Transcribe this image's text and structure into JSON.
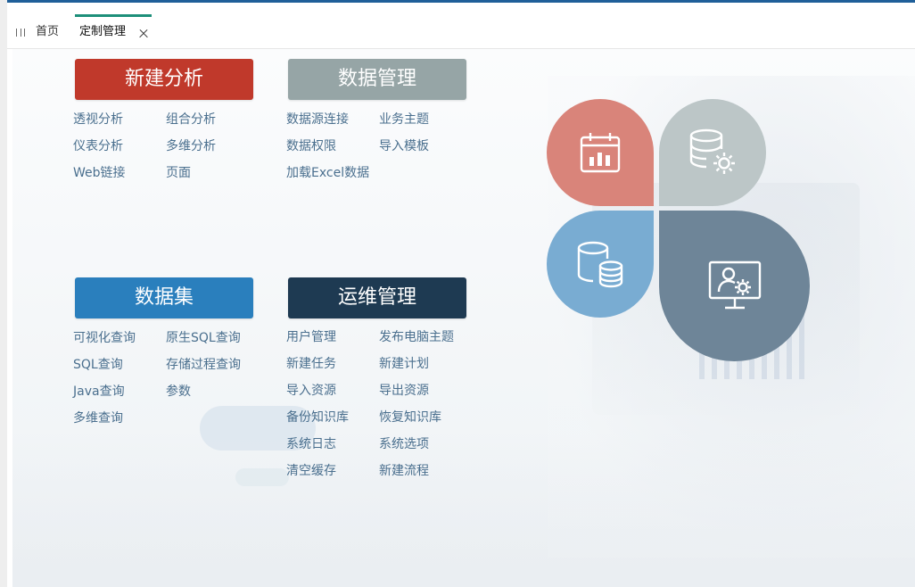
{
  "tabs": [
    {
      "label": "首页"
    },
    {
      "label": "定制管理"
    }
  ],
  "groups": {
    "new_analysis": {
      "title": "新建分析",
      "color": "#c0392b",
      "items": [
        "透视分析",
        "组合分析",
        "仪表分析",
        "多维分析",
        "Web链接",
        "页面"
      ]
    },
    "data_management": {
      "title": "数据管理",
      "color": "#96a5a6",
      "items": [
        "数据源连接",
        "业务主题",
        "数据权限",
        "导入模板",
        "加载Excel数据"
      ]
    },
    "dataset": {
      "title": "数据集",
      "color": "#2a7fbd",
      "items": [
        "可视化查询",
        "原生SQL查询",
        "SQL查询",
        "存储过程查询",
        "Java查询",
        "参数",
        "多维查询"
      ]
    },
    "operations": {
      "title": "运维管理",
      "color": "#1e3a52",
      "items": [
        "用户管理",
        "发布电脑主题",
        "新建任务",
        "新建计划",
        "导入资源",
        "导出资源",
        "备份知识库",
        "恢复知识库",
        "系统日志",
        "系统选项",
        "清空缓存",
        "新建流程"
      ]
    }
  },
  "graphic": {
    "petals": [
      {
        "icon": "calendar-chart-icon",
        "color": "#d9847a"
      },
      {
        "icon": "database-settings-icon",
        "color": "#bcc6c7"
      },
      {
        "icon": "database-stack-icon",
        "color": "#79acd2"
      },
      {
        "icon": "monitor-user-settings-icon",
        "color": "#6e8598"
      }
    ]
  }
}
